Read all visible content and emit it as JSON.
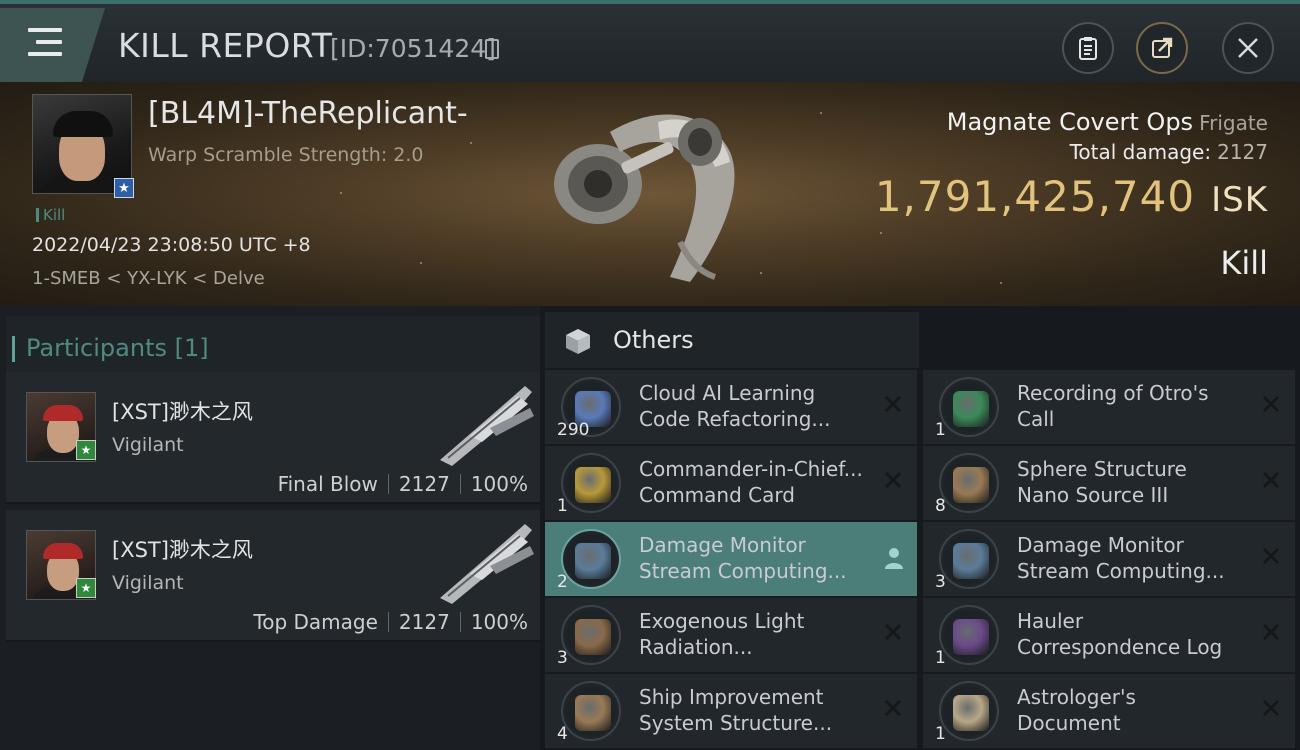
{
  "header": {
    "title": "KILL REPORT",
    "report_id": "[ID:7051424]",
    "icons": [
      "menu-icon",
      "clipboard-icon",
      "share-icon",
      "close-icon"
    ]
  },
  "victim": {
    "name": "[BL4M]-TheReplicant-",
    "warp_scramble": "Warp Scramble Strength: 2.0",
    "tag": "Kill",
    "datetime": "2022/04/23 23:08:50 UTC +8",
    "location": "1-SMEB < YX-LYK < Delve",
    "ship_name": "Magnate Covert Ops",
    "ship_class": "Frigate",
    "total_damage_label": "Total damage:",
    "total_damage_value": "2127",
    "isk_value": "1,791,425,740",
    "isk_unit": "ISK",
    "result": "Kill"
  },
  "participants": {
    "title": "Participants [1]",
    "cards": [
      {
        "name": "[XST]渺木之风",
        "ship": "Vigilant",
        "role": "Final Blow",
        "damage": "2127",
        "percent": "100%"
      },
      {
        "name": "[XST]渺木之风",
        "ship": "Vigilant",
        "role": "Top Damage",
        "damage": "2127",
        "percent": "100%"
      }
    ]
  },
  "others": {
    "title": "Others",
    "items": [
      {
        "qty": "290",
        "line1": "Cloud AI Learning",
        "line2": "Code Refactoring...",
        "icon": "ai-orb-icon",
        "selected": false,
        "color": "#5a7ab8"
      },
      {
        "qty": "1",
        "line1": "Recording of Otro's",
        "line2": "Call",
        "icon": "data-chip-icon",
        "selected": false,
        "color": "#3b8a5a"
      },
      {
        "qty": "1",
        "line1": "Commander-in-Chief...",
        "line2": "Command Card",
        "icon": "command-card-icon",
        "selected": false,
        "color": "#b89a3a"
      },
      {
        "qty": "8",
        "line1": "Sphere Structure",
        "line2": "Nano Source III",
        "icon": "sphere-structure-icon",
        "selected": false,
        "color": "#9a7a55"
      },
      {
        "qty": "2",
        "line1": "Damage Monitor",
        "line2": "Stream Computing...",
        "icon": "data-book-icon",
        "selected": true,
        "color": "#5b7c9a"
      },
      {
        "qty": "3",
        "line1": "Damage Monitor",
        "line2": "Stream Computing...",
        "icon": "data-book-icon",
        "selected": false,
        "color": "#5b7c9a"
      },
      {
        "qty": "3",
        "line1": "Exogenous Light",
        "line2": "Radiation...",
        "icon": "light-radiation-icon",
        "selected": false,
        "color": "#8a6a4a"
      },
      {
        "qty": "1",
        "line1": "Hauler",
        "line2": "Correspondence Log",
        "icon": "log-chip-icon",
        "selected": false,
        "color": "#6a4a8a"
      },
      {
        "qty": "4",
        "line1": "Ship Improvement",
        "line2": "System Structure...",
        "icon": "sphere-structure-icon",
        "selected": false,
        "color": "#9a7a55"
      },
      {
        "qty": "1",
        "line1": "Astrologer's",
        "line2": "Document",
        "icon": "document-icon",
        "selected": false,
        "color": "#b8a888"
      }
    ]
  }
}
